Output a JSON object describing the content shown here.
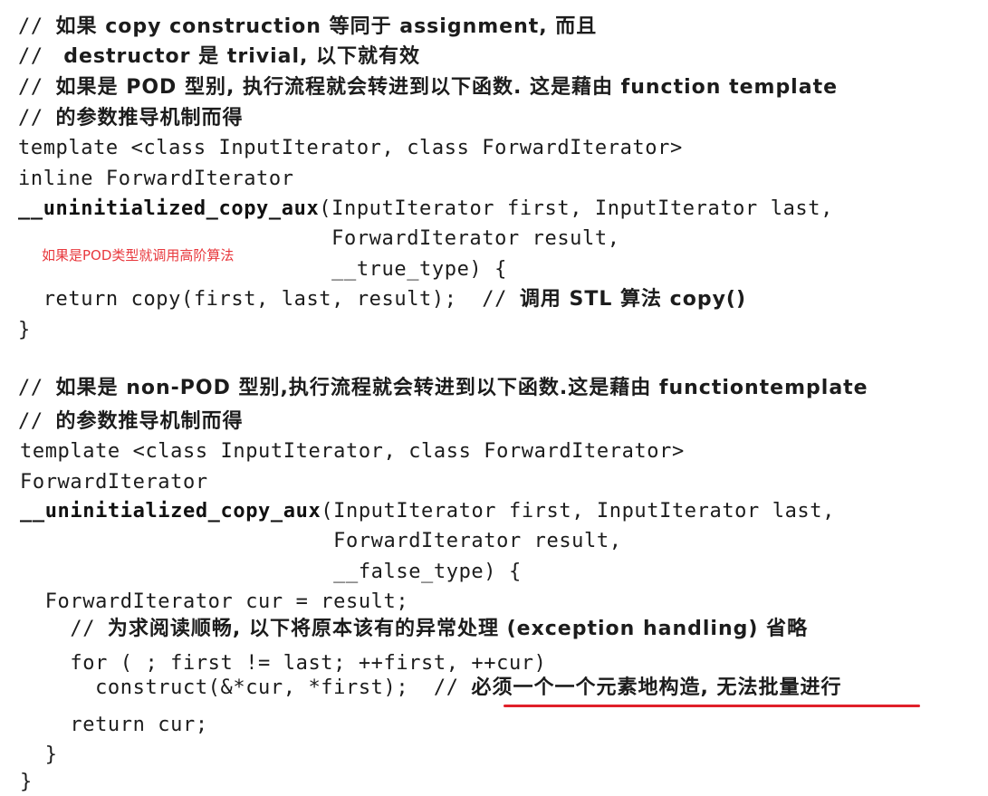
{
  "lines": [
    {
      "code": "// ",
      "cn": "如果 copy construction 等同于 assignment, 而且"
    },
    {
      "code": "// ",
      "cn": " destructor 是 trivial, 以下就有效"
    },
    {
      "code": "// ",
      "cn": "如果是 POD 型别, 执行流程就会转进到以下函数. 这是藉由 function template"
    },
    {
      "code": "// ",
      "cn": "的参数推导机制而得"
    },
    {
      "code": "template <class InputIterator, class ForwardIterator>"
    },
    {
      "code": "inline ForwardIterator"
    },
    {
      "bold": "__uninitialized_copy_aux",
      "code": "(InputIterator first, InputIterator last,"
    },
    {
      "code": "                         ForwardIterator result,"
    },
    {
      "code": "                         __true_type) {"
    },
    {
      "code": "  return copy(first, last, result);  // ",
      "cn": "调用 STL 算法 copy()"
    },
    {
      "code": "}"
    },
    {
      "code": "// ",
      "cn": "如果是 non-POD 型别,执行流程就会转进到以下函数.这是藉由 functiontemplate"
    },
    {
      "code": "// ",
      "cn": "的参数推导机制而得"
    },
    {
      "code": "template <class InputIterator, class ForwardIterator>"
    },
    {
      "code": "ForwardIterator"
    },
    {
      "bold": "__uninitialized_copy_aux",
      "code": "(InputIterator first, InputIterator last,"
    },
    {
      "code": "                         ForwardIterator result,"
    },
    {
      "code": "                         __false_type) {"
    },
    {
      "code": "  ForwardIterator cur = result;"
    },
    {
      "code": "    // ",
      "cn": "为求阅读顺畅, 以下将原本该有的异常处理 (exception handling) 省略"
    },
    {
      "code": "    for ( ; first != last; ++first, ++cur)"
    },
    {
      "code": "      construct(&*cur, *first);  // ",
      "cn": "必须一个一个元素地构造, 无法批量进行"
    },
    {
      "code": "    return cur;"
    },
    {
      "code": "  }"
    },
    {
      "code": "}"
    }
  ],
  "annotation": "如果是POD类型就调用高阶算法",
  "colors": {
    "annotation": "#e8383d",
    "underline": "#e0202a"
  }
}
